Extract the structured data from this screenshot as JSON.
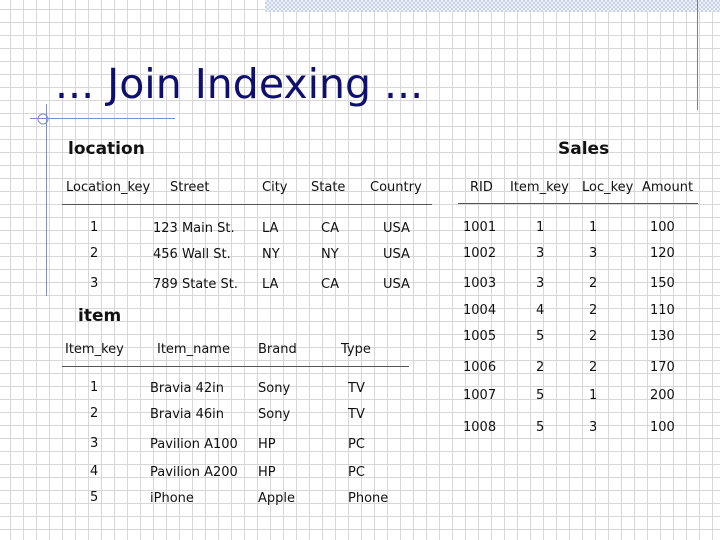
{
  "slide": {
    "title": "... Join Indexing ..."
  },
  "location": {
    "title": "location",
    "headers": [
      "Location_key",
      "Street",
      "City",
      "State",
      "Country"
    ],
    "rows": [
      [
        "1",
        "123 Main St.",
        "LA",
        "CA",
        "USA"
      ],
      [
        "2",
        "456 Wall St.",
        "NY",
        "NY",
        "USA"
      ],
      [
        "3",
        "789 State St.",
        "LA",
        "CA",
        "USA"
      ]
    ]
  },
  "item": {
    "title": "item",
    "headers": [
      "Item_key",
      "Item_name",
      "Brand",
      "Type"
    ],
    "rows": [
      [
        "1",
        "Bravia 42in",
        "Sony",
        "TV"
      ],
      [
        "2",
        "Bravia 46in",
        "Sony",
        "TV"
      ],
      [
        "3",
        "Pavilion A100",
        "HP",
        "PC"
      ],
      [
        "4",
        "Pavilion A200",
        "HP",
        "PC"
      ],
      [
        "5",
        "iPhone",
        "Apple",
        "Phone"
      ]
    ]
  },
  "sales": {
    "title": "Sales",
    "headers": [
      "RID",
      "Item_key",
      "Loc_key",
      "Amount"
    ],
    "rows": [
      [
        "1001",
        "1",
        "1",
        "100"
      ],
      [
        "1002",
        "3",
        "3",
        "120"
      ],
      [
        "1003",
        "3",
        "2",
        "150"
      ],
      [
        "1004",
        "4",
        "2",
        "110"
      ],
      [
        "1005",
        "5",
        "2",
        "130"
      ],
      [
        "1006",
        "2",
        "2",
        "170"
      ],
      [
        "1007",
        "5",
        "1",
        "200"
      ],
      [
        "1008",
        "5",
        "3",
        "100"
      ]
    ]
  }
}
